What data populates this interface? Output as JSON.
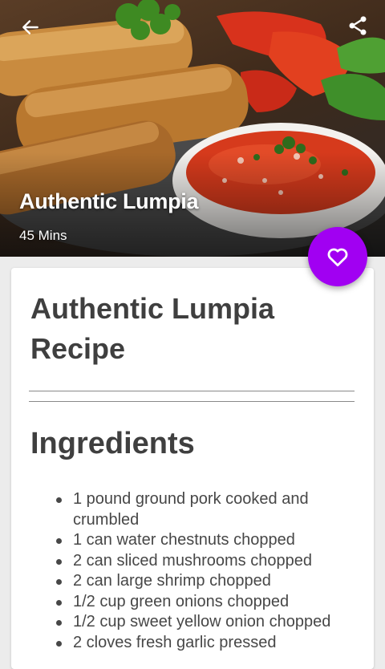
{
  "header": {
    "title": "Authentic Lumpia",
    "time": "45 Mins",
    "back_icon": "arrow-left-icon",
    "share_icon": "share-icon"
  },
  "favorite": {
    "icon": "heart-outline-icon",
    "color": "#a100f2"
  },
  "recipe": {
    "title": "Authentic Lumpia Recipe",
    "ingredients_heading": "Ingredients",
    "ingredients": [
      "1 pound ground pork cooked and crumbled",
      "1 can water chestnuts chopped",
      "2 can sliced mushrooms chopped",
      "2 can large shrimp chopped",
      "1/2 cup green onions chopped",
      "1/2 cup sweet yellow onion chopped",
      "2 cloves fresh garlic pressed"
    ]
  }
}
